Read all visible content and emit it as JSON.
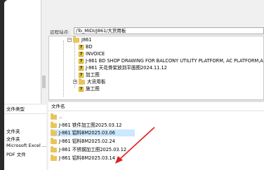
{
  "remote": {
    "site_label": "远程站点:",
    "path": "/To_MIDI/J861/大货用板",
    "tree": {
      "root": "J861",
      "items": [
        {
          "label": "BD",
          "icon": "question-folder-icon"
        },
        {
          "label": "INVOICE",
          "icon": "question-folder-icon"
        },
        {
          "label": "J-861 BD SHOP DRAWING FOR BALCONY UTILITY PLATFORM, AC PLATFORM,ALU...",
          "icon": "question-folder-icon"
        },
        {
          "label": "J-861 天花骨架放到平面图2024.11.12",
          "icon": "question-folder-icon"
        },
        {
          "label": "加工图",
          "icon": "question-folder-icon"
        },
        {
          "label": "大货用板",
          "icon": "folder-icon"
        },
        {
          "label": "施工图",
          "icon": "question-folder-icon"
        }
      ]
    },
    "files_header": "文件名",
    "files": [
      {
        "name": ".."
      },
      {
        "name": "J-861 铁件加工图2025.03.12"
      },
      {
        "name": "J-861 铝料BM2025.03.06"
      },
      {
        "name": "J-861 铝料BM2025.02.24"
      },
      {
        "name": "J-861 不锈钢加工图2025.03.12"
      },
      {
        "name": "J-861 铝料BM2025.03.14"
      }
    ]
  },
  "local": {
    "header": "文件类型",
    "types": [
      "文件夹",
      "文件夹",
      "Microsoft Excel ...",
      "PDF 文件"
    ]
  },
  "colors": {
    "selection": "#cce8ff",
    "annotation_arrow": "#e02020",
    "folder": "#e9c45a"
  }
}
